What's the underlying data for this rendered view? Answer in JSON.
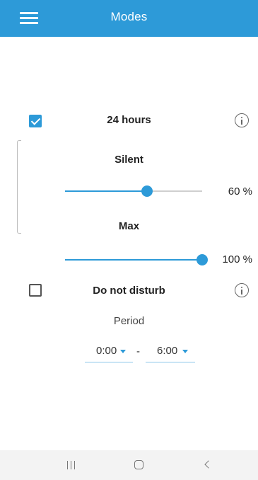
{
  "header": {
    "title": "Modes",
    "menu_icon": "hamburger-menu-icon"
  },
  "modes": {
    "full_day": {
      "label": "24 hours",
      "checked": true,
      "info_icon": "info-icon",
      "silent": {
        "label": "Silent",
        "value_percent": 60,
        "value_text": "60 %"
      },
      "max": {
        "label": "Max",
        "value_percent": 100,
        "value_text": "100 %"
      }
    },
    "do_not_disturb": {
      "label": "Do not disturb",
      "checked": false,
      "info_icon": "info-icon",
      "period_label": "Period",
      "start_time": "0:00",
      "separator": "-",
      "end_time": "6:00"
    }
  },
  "nav_bar": {
    "recent_icon": "recent-apps-icon",
    "home_icon": "home-icon",
    "back_icon": "back-icon"
  },
  "colors": {
    "accent": "#2d9ad8",
    "track": "#cfcfcf",
    "nav_background": "#f3f3f3"
  }
}
